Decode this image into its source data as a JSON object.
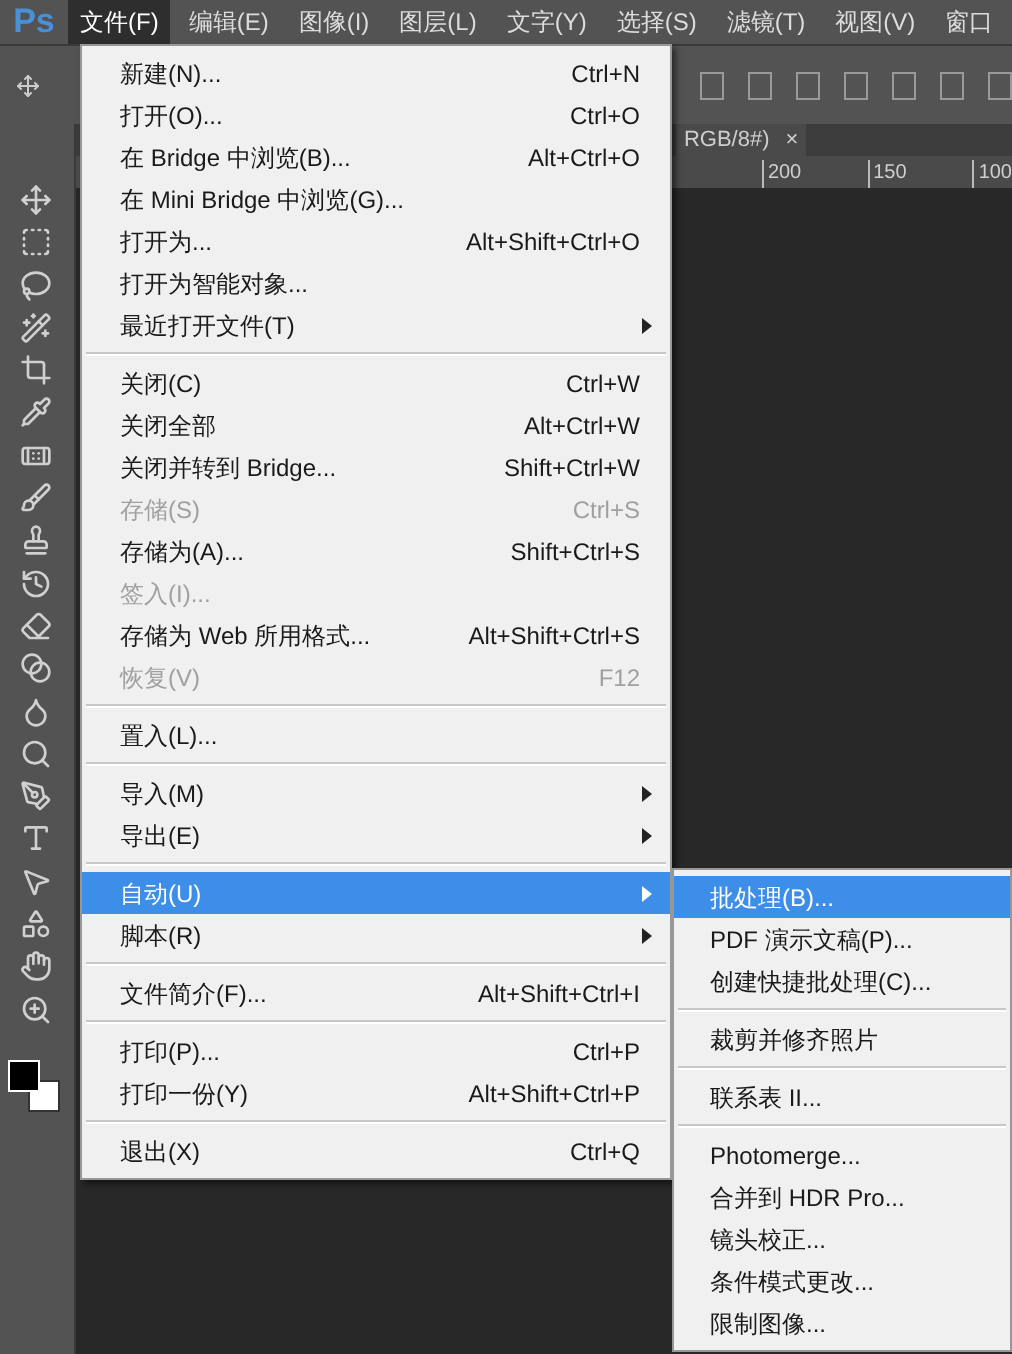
{
  "app": {
    "logo": "Ps"
  },
  "menubar": [
    {
      "label": "文件(F)",
      "selected": true
    },
    {
      "label": "编辑(E)",
      "selected": false
    },
    {
      "label": "图像(I)",
      "selected": false
    },
    {
      "label": "图层(L)",
      "selected": false
    },
    {
      "label": "文字(Y)",
      "selected": false
    },
    {
      "label": "选择(S)",
      "selected": false
    },
    {
      "label": "滤镜(T)",
      "selected": false
    },
    {
      "label": "视图(V)",
      "selected": false
    },
    {
      "label": "窗口",
      "selected": false
    }
  ],
  "document_tab": {
    "title": "RGB/8#)",
    "close": "×"
  },
  "ruler": {
    "marks": [
      "200",
      "150",
      "100"
    ]
  },
  "file_menu": {
    "items": [
      {
        "kind": "item",
        "label": "新建(N)...",
        "shortcut": "Ctrl+N",
        "disabled": false,
        "submenu": false,
        "selected": false
      },
      {
        "kind": "item",
        "label": "打开(O)...",
        "shortcut": "Ctrl+O",
        "disabled": false,
        "submenu": false,
        "selected": false
      },
      {
        "kind": "item",
        "label": "在 Bridge 中浏览(B)...",
        "shortcut": "Alt+Ctrl+O",
        "disabled": false,
        "submenu": false,
        "selected": false
      },
      {
        "kind": "item",
        "label": "在 Mini Bridge 中浏览(G)...",
        "disabled": false,
        "submenu": false,
        "selected": false
      },
      {
        "kind": "item",
        "label": "打开为...",
        "shortcut": "Alt+Shift+Ctrl+O",
        "disabled": false,
        "submenu": false,
        "selected": false
      },
      {
        "kind": "item",
        "label": "打开为智能对象...",
        "disabled": false,
        "submenu": false,
        "selected": false
      },
      {
        "kind": "item",
        "label": "最近打开文件(T)",
        "disabled": false,
        "submenu": true,
        "selected": false
      },
      {
        "kind": "separator"
      },
      {
        "kind": "item",
        "label": "关闭(C)",
        "shortcut": "Ctrl+W",
        "disabled": false,
        "submenu": false,
        "selected": false
      },
      {
        "kind": "item",
        "label": "关闭全部",
        "shortcut": "Alt+Ctrl+W",
        "disabled": false,
        "submenu": false,
        "selected": false
      },
      {
        "kind": "item",
        "label": "关闭并转到 Bridge...",
        "shortcut": "Shift+Ctrl+W",
        "disabled": false,
        "submenu": false,
        "selected": false
      },
      {
        "kind": "item",
        "label": "存储(S)",
        "shortcut": "Ctrl+S",
        "disabled": true,
        "submenu": false,
        "selected": false
      },
      {
        "kind": "item",
        "label": "存储为(A)...",
        "shortcut": "Shift+Ctrl+S",
        "disabled": false,
        "submenu": false,
        "selected": false
      },
      {
        "kind": "item",
        "label": "签入(I)...",
        "disabled": true,
        "submenu": false,
        "selected": false
      },
      {
        "kind": "item",
        "label": "存储为 Web 所用格式...",
        "shortcut": "Alt+Shift+Ctrl+S",
        "disabled": false,
        "submenu": false,
        "selected": false
      },
      {
        "kind": "item",
        "label": "恢复(V)",
        "shortcut": "F12",
        "disabled": true,
        "submenu": false,
        "selected": false
      },
      {
        "kind": "separator"
      },
      {
        "kind": "item",
        "label": "置入(L)...",
        "disabled": false,
        "submenu": false,
        "selected": false
      },
      {
        "kind": "separator"
      },
      {
        "kind": "item",
        "label": "导入(M)",
        "disabled": false,
        "submenu": true,
        "selected": false
      },
      {
        "kind": "item",
        "label": "导出(E)",
        "disabled": false,
        "submenu": true,
        "selected": false
      },
      {
        "kind": "separator"
      },
      {
        "kind": "item",
        "label": "自动(U)",
        "disabled": false,
        "submenu": true,
        "selected": true
      },
      {
        "kind": "item",
        "label": "脚本(R)",
        "disabled": false,
        "submenu": true,
        "selected": false
      },
      {
        "kind": "separator"
      },
      {
        "kind": "item",
        "label": "文件简介(F)...",
        "shortcut": "Alt+Shift+Ctrl+I",
        "disabled": false,
        "submenu": false,
        "selected": false
      },
      {
        "kind": "separator"
      },
      {
        "kind": "item",
        "label": "打印(P)...",
        "shortcut": "Ctrl+P",
        "disabled": false,
        "submenu": false,
        "selected": false
      },
      {
        "kind": "item",
        "label": "打印一份(Y)",
        "shortcut": "Alt+Shift+Ctrl+P",
        "disabled": false,
        "submenu": false,
        "selected": false
      },
      {
        "kind": "separator"
      },
      {
        "kind": "item",
        "label": "退出(X)",
        "shortcut": "Ctrl+Q",
        "disabled": false,
        "submenu": false,
        "selected": false
      }
    ]
  },
  "automate_submenu": {
    "items": [
      {
        "kind": "item",
        "label": "批处理(B)...",
        "selected": true
      },
      {
        "kind": "item",
        "label": "PDF 演示文稿(P)...",
        "selected": false
      },
      {
        "kind": "item",
        "label": "创建快捷批处理(C)...",
        "selected": false
      },
      {
        "kind": "separator"
      },
      {
        "kind": "item",
        "label": "裁剪并修齐照片",
        "selected": false
      },
      {
        "kind": "separator"
      },
      {
        "kind": "item",
        "label": "联系表 II...",
        "selected": false
      },
      {
        "kind": "separator"
      },
      {
        "kind": "item",
        "label": "Photomerge...",
        "selected": false
      },
      {
        "kind": "item",
        "label": "合并到 HDR Pro...",
        "selected": false
      },
      {
        "kind": "item",
        "label": "镜头校正...",
        "selected": false
      },
      {
        "kind": "item",
        "label": "条件模式更改...",
        "selected": false
      },
      {
        "kind": "item",
        "label": "限制图像...",
        "selected": false
      }
    ]
  }
}
